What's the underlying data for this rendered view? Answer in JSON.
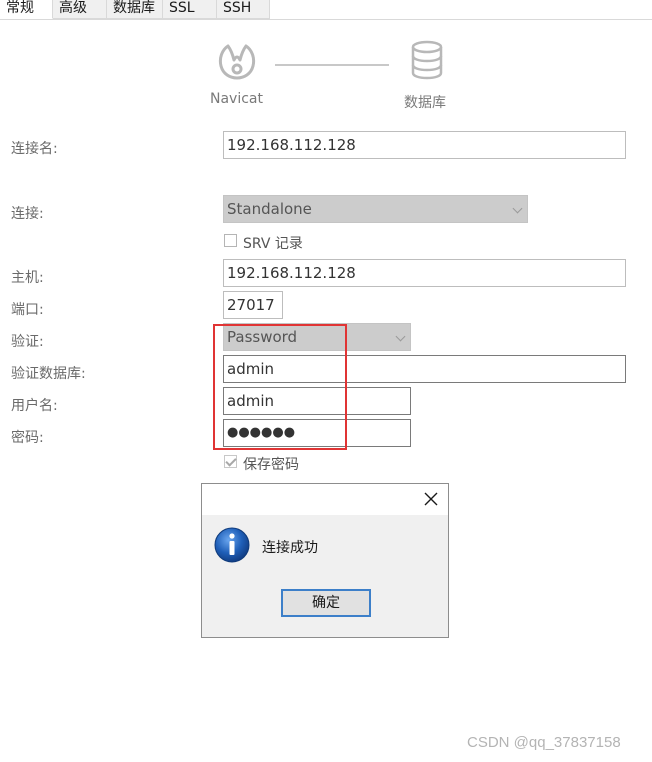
{
  "tabs": [
    {
      "label": "常规",
      "active": true
    },
    {
      "label": "高级",
      "active": false
    },
    {
      "label": "数据库",
      "active": false
    },
    {
      "label": "SSL",
      "active": false
    },
    {
      "label": "SSH",
      "active": false
    }
  ],
  "header": {
    "left_label": "Navicat",
    "right_label": "数据库",
    "left_icon": "navicat-logo-icon",
    "right_icon": "database-icon"
  },
  "form": {
    "connection_name": {
      "label": "连接名:",
      "value": "192.168.112.128"
    },
    "connection": {
      "label": "连接:",
      "value": "Standalone"
    },
    "srv": {
      "label": "SRV 记录",
      "checked": false
    },
    "host": {
      "label": "主机:",
      "value": "192.168.112.128"
    },
    "port": {
      "label": "端口:",
      "value": "27017"
    },
    "auth": {
      "label": "验证:",
      "value": "Password"
    },
    "auth_db": {
      "label": "验证数据库:",
      "value": "admin"
    },
    "username": {
      "label": "用户名:",
      "value": "admin"
    },
    "password": {
      "label": "密码:",
      "value": "●●●●●●"
    },
    "save_password": {
      "label": "保存密码",
      "checked": true
    }
  },
  "dialog": {
    "message": "连接成功",
    "ok_label": "确定",
    "icon": "info-icon",
    "close_icon": "close-icon"
  },
  "watermark": "CSDN @qq_37837158",
  "colors": {
    "highlight_box": "#e03434",
    "ok_button_border": "#3c7fc9",
    "info_icon_blue": "#1f5fb8"
  }
}
